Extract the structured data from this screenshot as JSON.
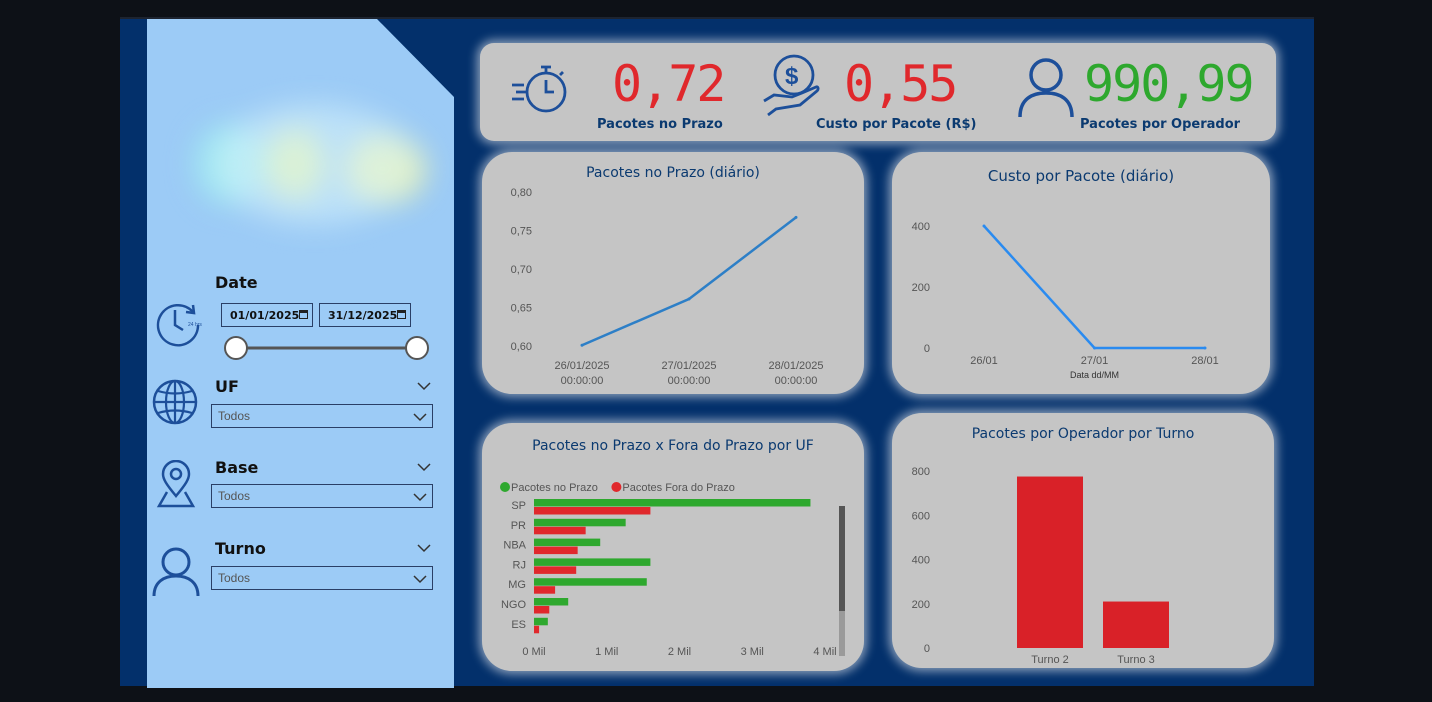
{
  "colors": {
    "canvas": "#03306b",
    "sidebar": "#9ccbf6",
    "card": "#c5c5c5",
    "red": "#e0282c",
    "green": "#2ea82e",
    "blue_line": "#2d7fc7",
    "bar_red": "#d92128",
    "title": "#0b3a70"
  },
  "filters": {
    "date": {
      "label": "Date",
      "start": "01/01/2025",
      "end": "31/12/2025",
      "icon": "clock-24h-icon"
    },
    "uf": {
      "label": "UF",
      "value": "Todos",
      "icon": "globe-icon"
    },
    "base": {
      "label": "Base",
      "value": "Todos",
      "icon": "location-pin-icon"
    },
    "turno": {
      "label": "Turno",
      "value": "Todos",
      "icon": "user-icon"
    }
  },
  "kpis": [
    {
      "value": "0,72",
      "label": "Pacotes no Prazo",
      "icon": "stopwatch-icon",
      "color": "#e0282c"
    },
    {
      "value": "0,55",
      "label": "Custo por Pacote (R$)",
      "icon": "money-hand-icon",
      "color": "#e0282c"
    },
    {
      "value": "990,99",
      "label": "Pacotes por Operador",
      "icon": "user-icon",
      "color": "#2ea82e"
    }
  ],
  "chart_data": [
    {
      "type": "line",
      "title": "Pacotes no Prazo (diário)",
      "x": [
        "26/01/2025 00:00:00",
        "27/01/2025 00:00:00",
        "28/01/2025 00:00:00"
      ],
      "x_lines": [
        [
          "26/01/2025",
          "00:00:00"
        ],
        [
          "27/01/2025",
          "00:00:00"
        ],
        [
          "28/01/2025",
          "00:00:00"
        ]
      ],
      "values": [
        0.601,
        0.661,
        0.767
      ],
      "yticks": [
        "0,60",
        "0,65",
        "0,70",
        "0,75",
        "0,80"
      ],
      "ylim": [
        0.6,
        0.8
      ],
      "xlabel": "",
      "ylabel": ""
    },
    {
      "type": "line",
      "title": "Custo por Pacote (diário)",
      "x": [
        "26/01",
        "27/01",
        "28/01"
      ],
      "values": [
        400,
        0,
        0
      ],
      "yticks": [
        "0",
        "200",
        "400"
      ],
      "ylim": [
        0,
        400
      ],
      "xlabel": "Data dd/MM",
      "ylabel": ""
    },
    {
      "type": "bar",
      "orientation": "horizontal",
      "title": "Pacotes no Prazo x Fora do Prazo por UF",
      "categories": [
        "SP",
        "PR",
        "NBA",
        "RJ",
        "MG",
        "NGO",
        "ES"
      ],
      "series": [
        {
          "name": "Pacotes no Prazo",
          "color": "#2ea82e",
          "values": [
            3800,
            1260,
            910,
            1600,
            1550,
            470,
            190
          ]
        },
        {
          "name": "Pacotes Fora do Prazo",
          "color": "#e0282c",
          "values": [
            1600,
            710,
            600,
            580,
            290,
            210,
            70
          ]
        }
      ],
      "xticks": [
        "0 Mil",
        "1 Mil",
        "2 Mil",
        "3 Mil",
        "4 Mil"
      ],
      "xlim": [
        0,
        4000
      ],
      "legend": "top-left"
    },
    {
      "type": "bar",
      "title": "Pacotes por Operador por Turno",
      "categories": [
        "Turno 2",
        "Turno 3"
      ],
      "values": [
        775,
        210
      ],
      "yticks": [
        "0",
        "200",
        "400",
        "600",
        "800"
      ],
      "ylim": [
        0,
        800
      ]
    }
  ]
}
